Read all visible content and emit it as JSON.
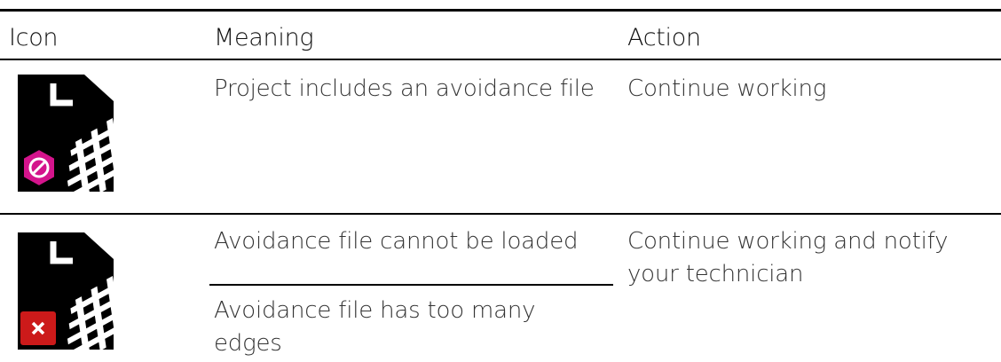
{
  "table": {
    "headers": {
      "icon": "Icon",
      "meaning": "Meaning",
      "action": "Action"
    },
    "rows": [
      {
        "icon": {
          "name": "avoidance-file-icon",
          "badge": "no-entry-badge",
          "badge_color": "#d4148c"
        },
        "meanings": [
          "Project includes an avoidance file"
        ],
        "action": "Continue working"
      },
      {
        "icon": {
          "name": "avoidance-file-icon",
          "badge": "error-x-badge",
          "badge_color": "#cc1a1a"
        },
        "meanings": [
          "Avoidance file cannot be loaded",
          "Avoidance file has too many edges"
        ],
        "action": "Continue working and notify your technician"
      }
    ]
  }
}
